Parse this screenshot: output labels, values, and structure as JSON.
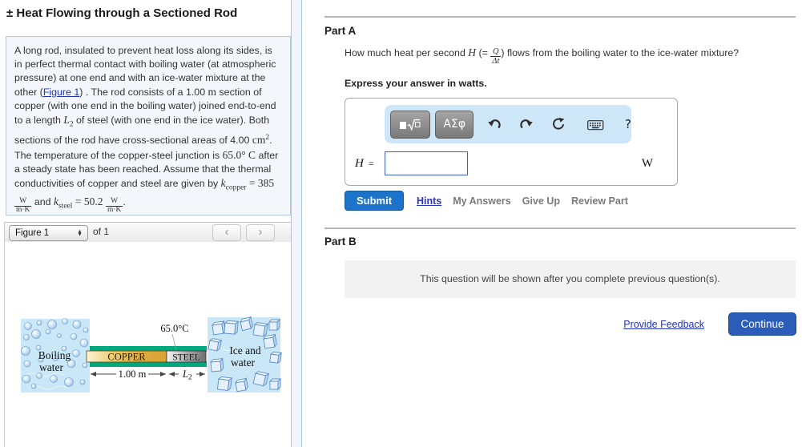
{
  "page": {
    "title": "± Heat Flowing through a Sectioned Rod"
  },
  "problem": {
    "text_1": "A long rod, insulated to prevent heat loss along its sides, is in perfect thermal contact with boiling water (at atmospheric pressure) at one end and with an ice-water mixture at the other (",
    "figure_link": "Figure 1",
    "text_2": ") . The rod consists of a 1.00 ",
    "unit_m": "m",
    "text_3": " section of copper (with one end in the boiling water) joined end-to-end to a length ",
    "var_L": "L",
    "var_L_sub": "2",
    "text_4": " of steel (with one end in the ice water). Both sections of the rod have cross-sectional areas of 4.00 ",
    "unit_cm": "cm",
    "unit_cm_sup": "2",
    "text_5": ". The temperature of the copper-steel junction is ",
    "temp": "65.0° C",
    "text_6": " after a steady state has been reached. Assume that the thermal conductivities of copper and steel are given by ",
    "var_k1": "k",
    "k1_sub": "copper",
    "k1_eq": "= 385",
    "frac1_num": "W",
    "frac1_den": "m·K",
    "text_7": " and ",
    "var_k2": "k",
    "k2_sub": "steel",
    "k2_eq": "= 50.2",
    "frac2_num": "W",
    "frac2_den": "m·K",
    "text_8": "."
  },
  "figure_panel": {
    "selector_label": "Figure 1",
    "of_label": "of 1"
  },
  "figure": {
    "left_label_1": "Boiling",
    "left_label_2": "water",
    "copper_label": "COPPER",
    "steel_label": "STEEL",
    "junction_temp": "65.0°C",
    "dim_copper": "1.00 m",
    "dim_steel": "L",
    "dim_steel_sub": "2",
    "right_label_1": "Ice and",
    "right_label_2": "water"
  },
  "part_a": {
    "heading": "Part A",
    "q_text_1": "How much heat per second ",
    "q_var": "H",
    "q_text_2": " (=",
    "q_frac_num": "Q",
    "q_frac_den": "Δt",
    "q_text_3": ") flows from the boiling water to the ice-water mixture?",
    "express": "Express your answer in watts.",
    "answer_var": "H",
    "equals": "=",
    "input_value": "",
    "unit": "W",
    "toolbar": {
      "greek_button": "ΑΣφ",
      "help": "?"
    },
    "submit": "Submit",
    "hints": "Hints",
    "my_answers": "My Answers",
    "give_up": "Give Up",
    "review": "Review Part"
  },
  "part_b": {
    "heading": "Part B",
    "locked_message": "This question will be shown after you complete previous question(s)."
  },
  "footer": {
    "feedback": "Provide Feedback",
    "continue": "Continue"
  },
  "icons": {
    "dropdown_up": "▲",
    "dropdown_down": "▼",
    "prev": "‹",
    "next": "›"
  },
  "colors": {
    "accent_blue": "#1b74c9",
    "continue_blue": "#2a5cb8",
    "toolbar_blue": "#cde6f8",
    "panel_blue": "#f3f7fb",
    "link_blue": "#2233bb",
    "insulation_green": "#00a87e",
    "copper_gold": "#ddaa3e",
    "steel_gray": "#9a9a9a",
    "water_blue": "#c9e7f6"
  }
}
